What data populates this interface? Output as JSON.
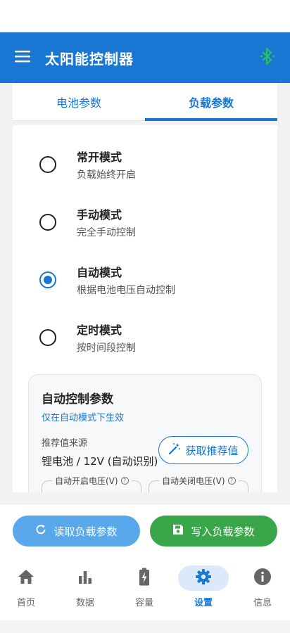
{
  "app": {
    "title": "太阳能控制器",
    "menu_icon": "menu-icon",
    "bluetooth_icon": "bluetooth-icon",
    "accent_color": "#1976d2",
    "bluetooth_color": "#22c55e"
  },
  "tabs": [
    {
      "label": "电池参数",
      "active": false
    },
    {
      "label": "负载参数",
      "active": true
    }
  ],
  "modes": [
    {
      "title": "常开模式",
      "desc": "负载始终开启",
      "selected": false
    },
    {
      "title": "手动模式",
      "desc": "完全手动控制",
      "selected": false
    },
    {
      "title": "自动模式",
      "desc": "根据电池电压自动控制",
      "selected": true
    },
    {
      "title": "定时模式",
      "desc": "按时间段控制",
      "selected": false
    }
  ],
  "auto_params": {
    "title": "自动控制参数",
    "subtitle": "仅在自动模式下生效",
    "recommend_source_label": "推荐值来源",
    "recommend_source_value": "锂电池 / 12V (自动识别)",
    "get_recommend_label": "获取推荐值",
    "fields": [
      {
        "label": "自动开启电压(V)"
      },
      {
        "label": "自动关闭电压(V)"
      }
    ]
  },
  "actions": {
    "read_label": "读取负载参数",
    "write_label": "写入负载参数",
    "read_color": "#5aa8ec",
    "write_color": "#3aa64a"
  },
  "nav": [
    {
      "label": "首页",
      "icon": "home-icon",
      "active": false
    },
    {
      "label": "数据",
      "icon": "bar-chart-icon",
      "active": false
    },
    {
      "label": "容量",
      "icon": "battery-charging-icon",
      "active": false
    },
    {
      "label": "设置",
      "icon": "gear-icon",
      "active": true
    },
    {
      "label": "信息",
      "icon": "info-icon",
      "active": false
    }
  ]
}
